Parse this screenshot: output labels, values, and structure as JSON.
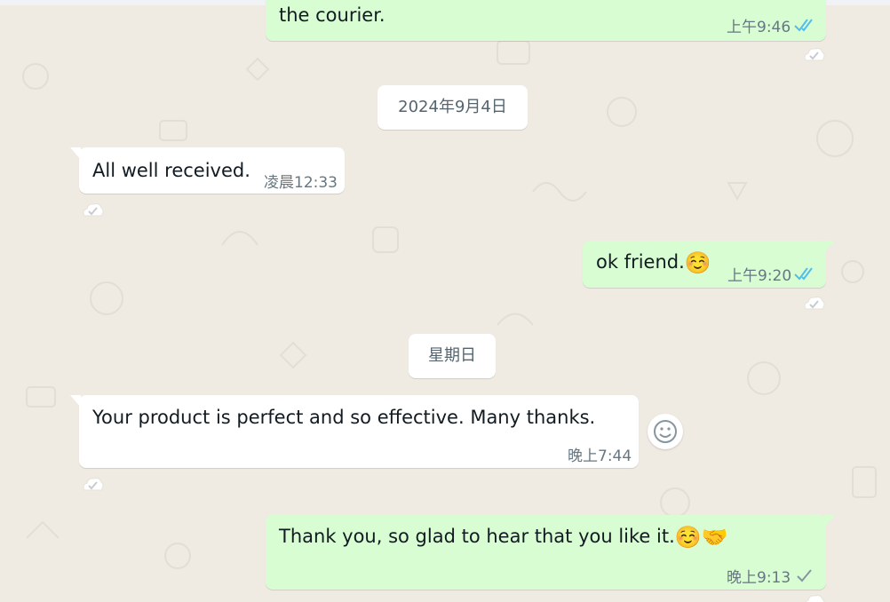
{
  "colors": {
    "background": "#efeae2",
    "outgoing_bubble": "#d9fdd3",
    "incoming_bubble": "#ffffff",
    "read_ticks": "#53bdeb",
    "sent_tick": "#8696a0",
    "meta_text": "#667781"
  },
  "messages": [
    {
      "direction": "outgoing",
      "text": "the courier.",
      "time": "上午9:46",
      "status": "read",
      "status_icon": "double-check-icon"
    },
    {
      "direction": "incoming",
      "text": "All well received.",
      "time": "凌晨12:33"
    },
    {
      "direction": "outgoing",
      "text": "ok friend.",
      "emoji": "☺️",
      "time": "上午9:20",
      "status": "read",
      "status_icon": "double-check-icon"
    },
    {
      "direction": "incoming",
      "text": "Your product is perfect and so effective. Many thanks.",
      "time": "晚上7:44"
    },
    {
      "direction": "outgoing",
      "text": "Thank you, so glad to hear that you like it.",
      "emoji": "☺️🤝",
      "time": "晚上9:13",
      "status": "sent",
      "status_icon": "single-check-icon"
    }
  ],
  "date_separators": [
    {
      "label": "2024年9月4日"
    },
    {
      "label": "星期日"
    }
  ],
  "icons": {
    "reaction_badge": "reaction-check-icon",
    "emoji_picker": "smiley-icon"
  }
}
